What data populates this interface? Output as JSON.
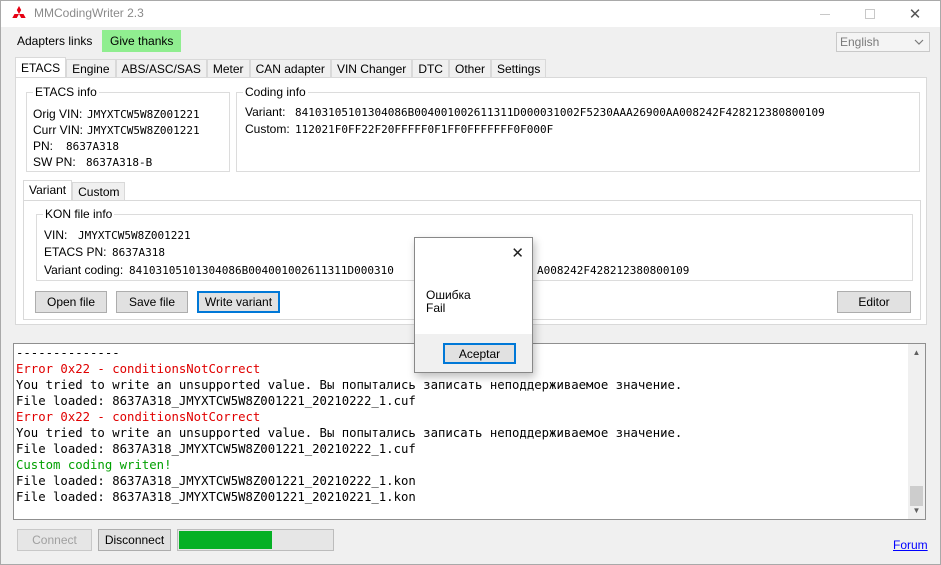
{
  "window": {
    "title": "MMCodingWriter 2.3"
  },
  "menu": {
    "adapters_links": "Adapters links",
    "give_thanks": "Give thanks",
    "give_thanks_color": "#90ee90"
  },
  "language": {
    "selected": "English"
  },
  "tabs": [
    "ETACS",
    "Engine",
    "ABS/ASC/SAS",
    "Meter",
    "CAN adapter",
    "VIN Changer",
    "DTC",
    "Other",
    "Settings"
  ],
  "etacs_info": {
    "title": "ETACS info",
    "orig_vin_label": "Orig VIN:",
    "orig_vin": "JMYXTCW5W8Z001221",
    "curr_vin_label": "Curr VIN:",
    "curr_vin": "JMYXTCW5W8Z001221",
    "pn_label": "PN:",
    "pn": "8637A318",
    "sw_pn_label": "SW PN:",
    "sw_pn": "8637A318-B"
  },
  "coding_info": {
    "title": "Coding info",
    "variant_label": "Variant:",
    "variant": "84103105101304086B004001002611311D000031002F5230AAA26900AA008242F428212380800109",
    "custom_label": "Custom:",
    "custom": "112021F0FF22F20FFFFF0F1FF0FFFFFFF0F000F"
  },
  "subtabs": [
    "Variant",
    "Custom"
  ],
  "kon_info": {
    "title": "KON file info",
    "vin_label": "VIN:",
    "vin": "JMYXTCW5W8Z001221",
    "etacs_pn_label": "ETACS PN:",
    "etacs_pn": "8637A318",
    "variant_coding_label": "Variant coding:",
    "variant_coding_left": "84103105101304086B004001002611311D000310",
    "variant_coding_right": "A008242F428212380800109"
  },
  "buttons": {
    "open_file": "Open file",
    "save_file": "Save file",
    "write_variant": "Write variant",
    "editor": "Editor",
    "connect": "Connect",
    "disconnect": "Disconnect"
  },
  "log": [
    {
      "type": "info",
      "text": "--------------"
    },
    {
      "type": "error",
      "text": "Error 0x22 - conditionsNotCorrect"
    },
    {
      "type": "info",
      "text": "You tried to write an unsupported value. Вы попытались записать неподдерживаемое значение."
    },
    {
      "type": "info",
      "text": "File loaded: 8637A318_JMYXTCW5W8Z001221_20210222_1.cuf"
    },
    {
      "type": "error",
      "text": "Error 0x22 - conditionsNotCorrect"
    },
    {
      "type": "info",
      "text": "You tried to write an unsupported value. Вы попытались записать неподдерживаемое значение."
    },
    {
      "type": "info",
      "text": "File loaded: 8637A318_JMYXTCW5W8Z001221_20210222_1.cuf"
    },
    {
      "type": "success",
      "text": "Custom coding writen!"
    },
    {
      "type": "info",
      "text": "File loaded: 8637A318_JMYXTCW5W8Z001221_20210222_1.kon"
    },
    {
      "type": "info",
      "text": "File loaded: 8637A318_JMYXTCW5W8Z001221_20210221_1.kon"
    }
  ],
  "progress": {
    "value_percent": 61,
    "color": "#06b025"
  },
  "forum": {
    "label": "Forum"
  },
  "dialog": {
    "title_line": "Ошибка",
    "message": "Fail",
    "ok": "Aceptar"
  }
}
